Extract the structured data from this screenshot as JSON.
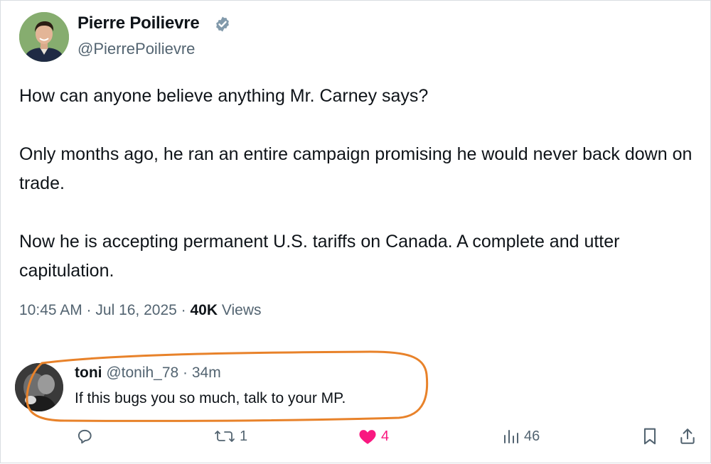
{
  "post": {
    "author": {
      "name": "Pierre Poilievre",
      "handle": "@PierrePoilievre",
      "verified": true
    },
    "paragraphs": [
      "How can anyone believe anything Mr. Carney says?",
      "Only months ago, he ran an entire campaign promising he would never back down on trade.",
      "Now he is accepting permanent U.S. tariffs on Canada. A complete and utter capitulation."
    ],
    "timestamp": "10:45 AM · Jul 16, 2025 · ",
    "views_count": "40K",
    "views_label": " Views"
  },
  "reply": {
    "name": "toni",
    "meta": " @tonih_78 · 34m",
    "text": "If this bugs you so much, talk to your MP.",
    "highlight_color": "#e8822a"
  },
  "actions": {
    "reply_icon": "reply-icon",
    "retweet_count": "1",
    "like_count": "4",
    "like_color": "#f91880",
    "views_count": "46"
  },
  "colors": {
    "text": "#0f1419",
    "secondary": "#536471",
    "verified": "#829aab"
  }
}
